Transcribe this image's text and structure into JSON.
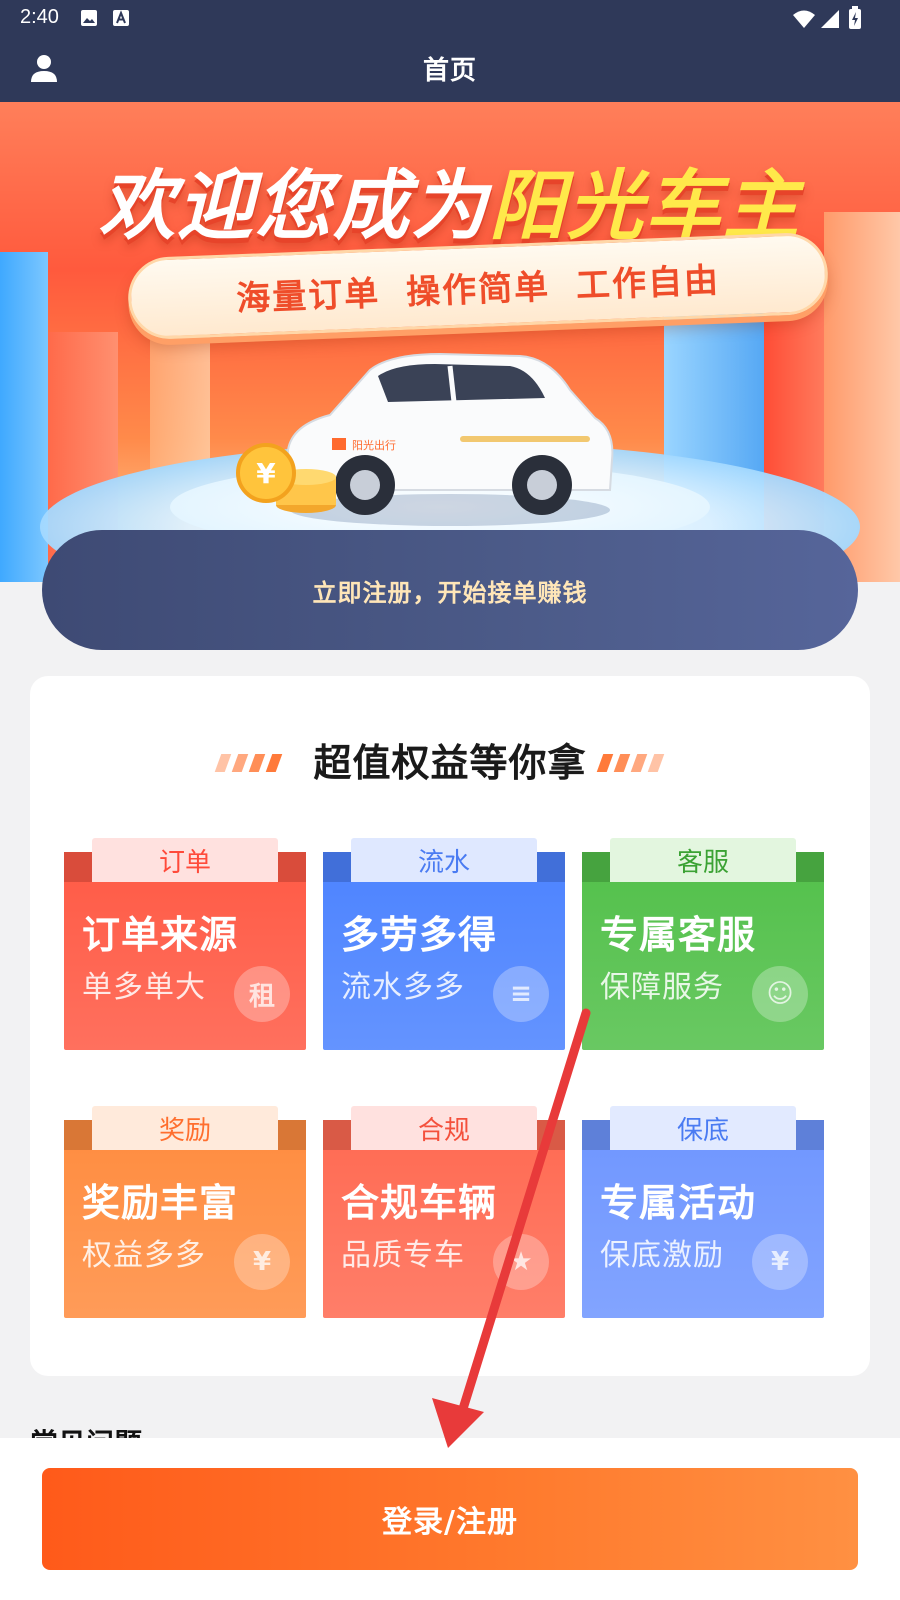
{
  "status_bar": {
    "time": "2:40"
  },
  "app_bar": {
    "title": "首页",
    "user_icon": "user-icon"
  },
  "banner": {
    "title_white": "欢迎您成为",
    "title_yellow": "阳光车主",
    "slogans": [
      "海量订单",
      "操作简单",
      "工作自由"
    ],
    "car_label": "阳光出行"
  },
  "register_cta": "立即注册，开始接单赚钱",
  "benefits": {
    "heading": "超值权益等你拿",
    "tiles": [
      {
        "tab": "订单",
        "title": "订单来源",
        "subtitle": "单多单大",
        "badge": "租",
        "color": "#ff5a45",
        "tab_bg": "#ffe1df",
        "tab_fg": "#ff4a3a"
      },
      {
        "tab": "流水",
        "title": "多劳多得",
        "subtitle": "流水多多",
        "badge": "≡",
        "color": "#4c83ff",
        "tab_bg": "#dfe8ff",
        "tab_fg": "#4a7bf2"
      },
      {
        "tab": "客服",
        "title": "专属客服",
        "subtitle": "保障服务",
        "badge": "☺",
        "color": "#52c04a",
        "tab_bg": "#e3f6df",
        "tab_fg": "#3ba234"
      },
      {
        "tab": "奖励",
        "title": "奖励丰富",
        "subtitle": "权益多多",
        "badge": "¥",
        "color": "#ff8c3f",
        "tab_bg": "#ffeadb",
        "tab_fg": "#ff6e2e"
      },
      {
        "tab": "合规",
        "title": "合规车辆",
        "subtitle": "品质专车",
        "badge": "★",
        "color": "#ff6a52",
        "tab_bg": "#ffe1df",
        "tab_fg": "#f4503c"
      },
      {
        "tab": "保底",
        "title": "专属活动",
        "subtitle": "保底激励",
        "badge": "¥",
        "color": "#6f96ff",
        "tab_bg": "#e2eaff",
        "tab_fg": "#4a7bf2"
      }
    ]
  },
  "faq_title": "常见问题",
  "login_button": "登录/注册",
  "colors": {
    "header": "#2f3959",
    "accent_orange": "#ff5a1a",
    "register_text": "#ffe6b8",
    "arrow": "#e83a3a"
  }
}
